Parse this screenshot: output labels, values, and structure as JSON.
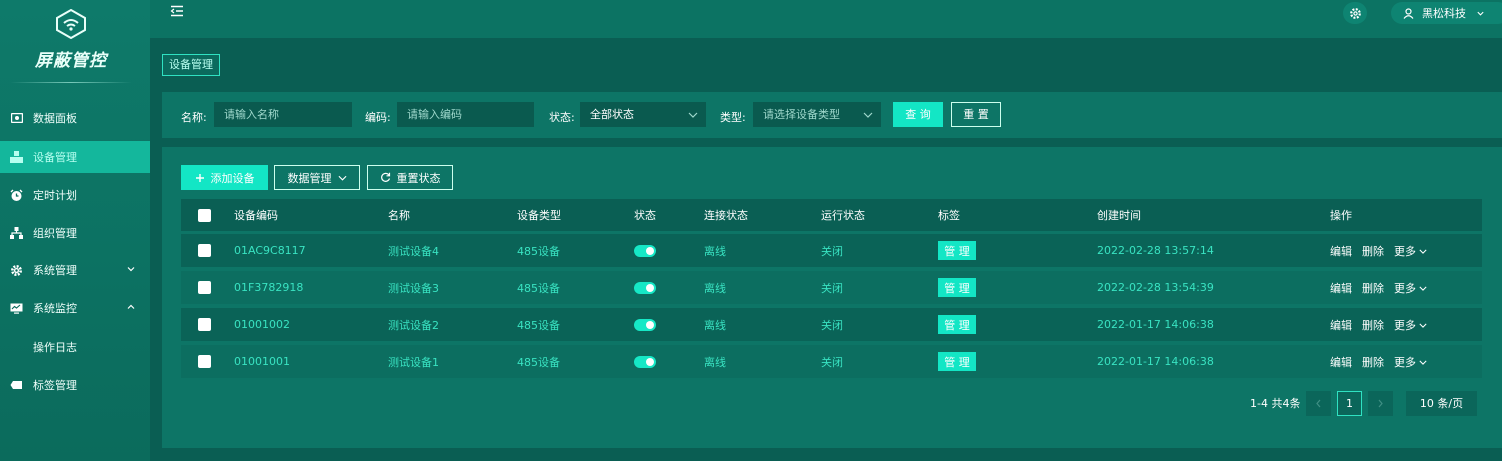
{
  "app": {
    "title": "屏蔽管控"
  },
  "sidebar": {
    "items": [
      {
        "label": "数据面板",
        "icon": "dashboard-icon"
      },
      {
        "label": "设备管理",
        "icon": "device-icon",
        "active": true
      },
      {
        "label": "定时计划",
        "icon": "alarm-clock-icon"
      },
      {
        "label": "组织管理",
        "icon": "org-tree-icon"
      },
      {
        "label": "系统管理",
        "icon": "gear-icon",
        "expand": "collapsed"
      },
      {
        "label": "系统监控",
        "icon": "monitor-icon",
        "expand": "expanded"
      },
      {
        "label": "操作日志",
        "sub": true
      },
      {
        "label": "标签管理",
        "icon": "tag-icon"
      }
    ]
  },
  "header": {
    "user_name": "黑松科技",
    "icons": [
      "menu-fold-icon",
      "settings-icon",
      "user-icon"
    ]
  },
  "breadcrumb": {
    "label": "设备管理"
  },
  "filters": {
    "name_label": "名称:",
    "name_placeholder": "请输入名称",
    "code_label": "编码:",
    "code_placeholder": "请输入编码",
    "status_label": "状态:",
    "status_value": "全部状态",
    "type_label": "类型:",
    "type_placeholder": "请选择设备类型",
    "query_button": "查 询",
    "reset_button": "重 置"
  },
  "toolbar": {
    "add_label": "添加设备",
    "data_manage_label": "数据管理",
    "reset_status_label": "重置状态"
  },
  "table": {
    "headers": {
      "code": "设备编码",
      "name": "名称",
      "type": "设备类型",
      "status": "状态",
      "connection": "连接状态",
      "running": "运行状态",
      "tag": "标签",
      "created": "创建时间",
      "actions": "操作"
    },
    "rows": [
      {
        "code": "01AC9C8117",
        "name": "测试设备4",
        "type": "485设备",
        "status_on": true,
        "connection": "离线",
        "running": "关闭",
        "tag_button": "管 理",
        "created": "2022-02-28 13:57:14"
      },
      {
        "code": "01F3782918",
        "name": "测试设备3",
        "type": "485设备",
        "status_on": true,
        "connection": "离线",
        "running": "关闭",
        "tag_button": "管 理",
        "created": "2022-02-28 13:54:39"
      },
      {
        "code": "01001002",
        "name": "测试设备2",
        "type": "485设备",
        "status_on": true,
        "connection": "离线",
        "running": "关闭",
        "tag_button": "管 理",
        "created": "2022-01-17 14:06:38"
      },
      {
        "code": "01001001",
        "name": "测试设备1",
        "type": "485设备",
        "status_on": true,
        "connection": "离线",
        "running": "关闭",
        "tag_button": "管 理",
        "created": "2022-01-17 14:06:38"
      }
    ],
    "row_actions": {
      "edit": "编辑",
      "delete": "删除",
      "more": "更多"
    }
  },
  "pagination": {
    "total": "1-4 共4条",
    "current_page": "1",
    "page_size": "10 条/页"
  },
  "colors": {
    "accent": "#13e6c5",
    "sidebar": "#0e7a6a",
    "panel": "#0d7566",
    "link": "#39e3c2"
  }
}
